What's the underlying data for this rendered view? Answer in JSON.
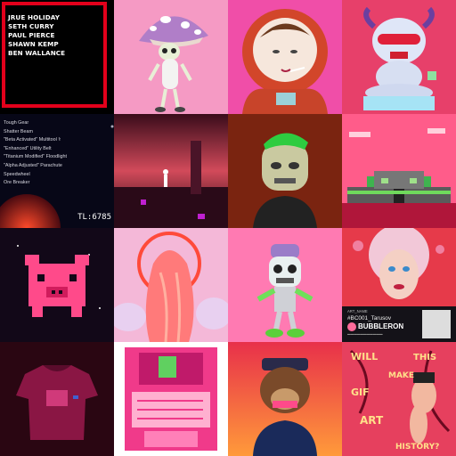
{
  "gallery": {
    "tile_1": {
      "names": [
        "JRUE HOLIDAY",
        "SETH CURRY",
        "PAUL PIERCE",
        "SHAWN KEMP",
        "BEN WALLANCE"
      ]
    },
    "tile_5": {
      "items": [
        "Tough Gear",
        "Shatter Beam",
        "\"Beta Activated\" Multitool ⚕",
        "\"Enhanced\" Utility Belt",
        "\"Titanium Modified\" Floodlight",
        "\"Alpha Adjusted\" Parachute",
        "Speedwheel",
        "Ore Breaker"
      ],
      "tl": "TL:6785"
    },
    "tile_12": {
      "art_name": "ART_NAME",
      "handle": "#BC001_Tarusov",
      "brand": "BUBBLERON"
    },
    "tile_16": {
      "words": [
        "WILL",
        "THIS",
        "GIF",
        "MAKE",
        "ART",
        "HISTORY?"
      ]
    }
  },
  "colors": {
    "red_frame": "#e3001b",
    "pink": "#ff6b9a"
  }
}
